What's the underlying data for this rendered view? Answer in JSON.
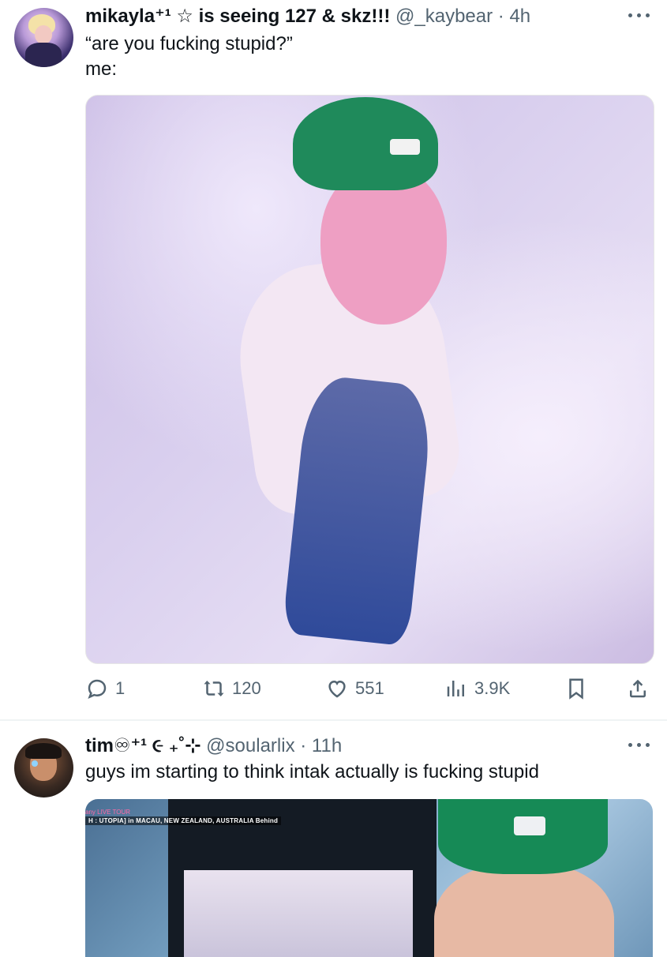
{
  "tweet1": {
    "name": "mikayla⁺¹ ☆ is seeing 127 & skz!!!",
    "handle": "@_kaybear",
    "separator": "·",
    "time": "4h",
    "text_line1": "“are you fucking stupid?”",
    "text_line2": "me:",
    "replies": "1",
    "retweets": "120",
    "likes": "551",
    "views": "3.9K"
  },
  "tweet2": {
    "name": "tim♾⁺¹ ૯ ₊˚⊹",
    "handle": "@soularlix",
    "separator": "·",
    "time": "11h",
    "text": "guys im starting to think intak actually is fucking stupid",
    "media_caption_tour": "any LIVE TOUR",
    "media_caption": "H : UTOPIA] in MACAU, NEW ZEALAND, AUSTRALIA Behind"
  },
  "icons": {
    "reply": "reply-icon",
    "retweet": "retweet-icon",
    "like": "heart-icon",
    "views": "views-chart-icon",
    "bookmark": "bookmark-icon",
    "share": "share-icon",
    "more": "more-dots-icon"
  },
  "colors": {
    "text_primary": "#0f1419",
    "text_secondary": "#536471",
    "divider": "#eff3f4"
  }
}
